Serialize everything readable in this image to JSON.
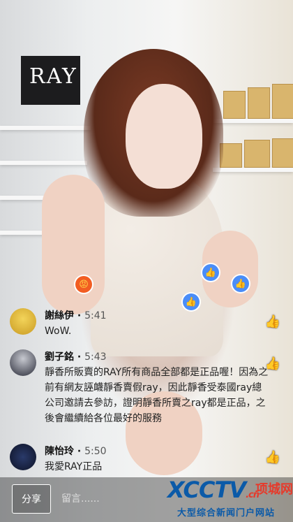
{
  "store": {
    "logo_text": "RAY"
  },
  "reactions": [
    {
      "type": "angry",
      "icon": "😡"
    },
    {
      "type": "like",
      "icon": "👍"
    },
    {
      "type": "like",
      "icon": "👍"
    },
    {
      "type": "like",
      "icon": "👍"
    }
  ],
  "comments": [
    {
      "name": "謝絲伊",
      "time": "5:41",
      "text": "WoW.",
      "avatar_color": "#e8c74a"
    },
    {
      "name": "劉子銘",
      "time": "5:43",
      "text": "靜香所販賣的RAY所有商品全部都是正品喔！因為之前有網友誣衊靜香賣假ray，因此靜香受泰國ray總公司邀請去參訪，證明靜香所賣之ray都是正品，之後會繼續給各位最好的服務",
      "avatar_color": "#2b2d3a"
    },
    {
      "name": "陳怡玲",
      "time": "5:50",
      "text": "我愛RAY正品",
      "avatar_color": "#1a2340"
    }
  ],
  "bottom_bar": {
    "share_label": "分享",
    "input_placeholder": "留言......"
  },
  "watermark": {
    "logo": "XCCTV",
    "logo_suffix": ".cn",
    "brand": "项城网",
    "tagline": "大型综合新闻门户网站"
  }
}
